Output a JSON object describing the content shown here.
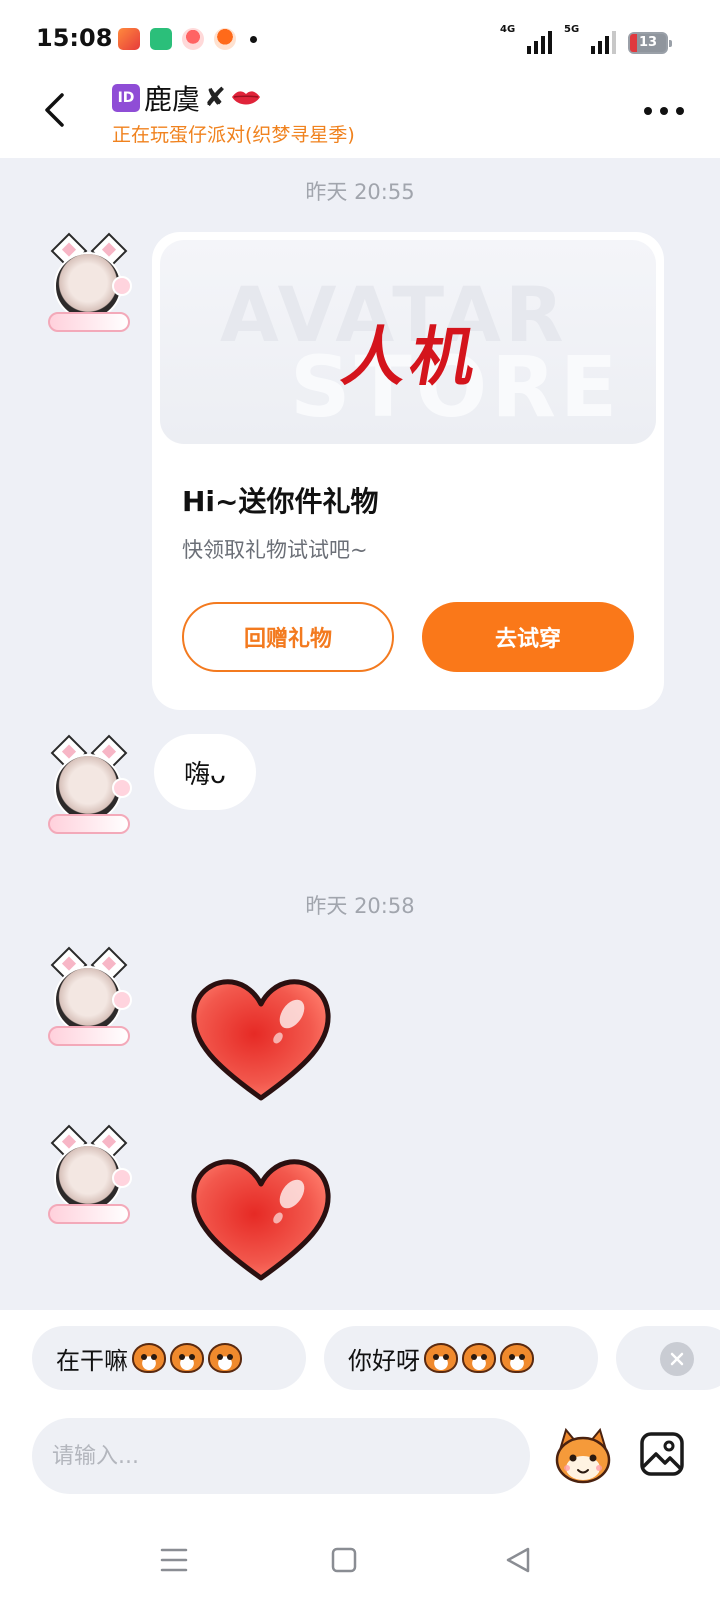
{
  "status_bar": {
    "time": "15:08",
    "signal_1": "4G",
    "signal_2": "5G",
    "battery": "13",
    "accent_battery_low": "#e0393e"
  },
  "header": {
    "badge": "ID",
    "name": "鹿虞",
    "x_mark": "✘",
    "subtitle": "正在玩蛋仔派对(织梦寻星季)",
    "back_icon": "chevron-left-icon",
    "more_icon": "more-dots-icon"
  },
  "chat": {
    "timestamp_1": "昨天 20:55",
    "gift_card": {
      "banner_watermark_1": "AVATAR",
      "banner_watermark_2": "STORE",
      "banner_calligraphy": "人机",
      "title": "Hi~送你件礼物",
      "subtitle": "快领取礼物试试吧~",
      "button_return_gift": "回赠礼物",
      "button_try_on": "去试穿"
    },
    "bubble_text": "嗨ᴗ",
    "timestamp_2": "昨天 20:58",
    "heart_sticker": "heart-sticker"
  },
  "quick_replies": [
    {
      "text": "在干嘛"
    },
    {
      "text": "你好呀"
    }
  ],
  "input": {
    "placeholder": "请输入..."
  },
  "colors": {
    "accent_orange": "#fa7819",
    "subtitle_orange": "#f0821e",
    "chat_bg": "#eef0f6"
  }
}
